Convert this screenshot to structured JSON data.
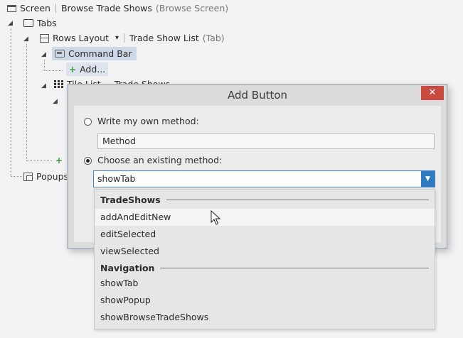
{
  "tree": {
    "screen_label": "Screen",
    "screen_name": "Browse Trade Shows",
    "screen_kind": "(Browse Screen)",
    "tabs_label": "Tabs",
    "rows_layout_label": "Rows Layout",
    "rows_layout_dropdown": "▾",
    "trade_show_list_label": "Trade Show List",
    "trade_show_list_kind": "(Tab)",
    "command_bar_label": "Command Bar",
    "add_label": "Add...",
    "tile_list_label": "Tile List",
    "trade_shows_partial": "Trade Shows",
    "popups_label": "Popups"
  },
  "dialog": {
    "title": "Add Button",
    "close_glyph": "✕",
    "option_own_label": "Write my own method:",
    "method_value": "Method",
    "option_existing_label": "Choose an existing method:",
    "selected_method": "showTab",
    "combo_arrow": "▼"
  },
  "dropdown": {
    "groups": [
      {
        "header": "TradeShows",
        "items": [
          "addAndEditNew",
          "editSelected",
          "viewSelected"
        ]
      },
      {
        "header": "Navigation",
        "items": [
          "showTab",
          "showPopup",
          "showBrowseTradeShows"
        ]
      }
    ],
    "hovered_item": "addAndEditNew"
  },
  "colors": {
    "accent": "#2f7bc2",
    "close_button": "#c94a3e",
    "selection": "#cfd8e6"
  }
}
